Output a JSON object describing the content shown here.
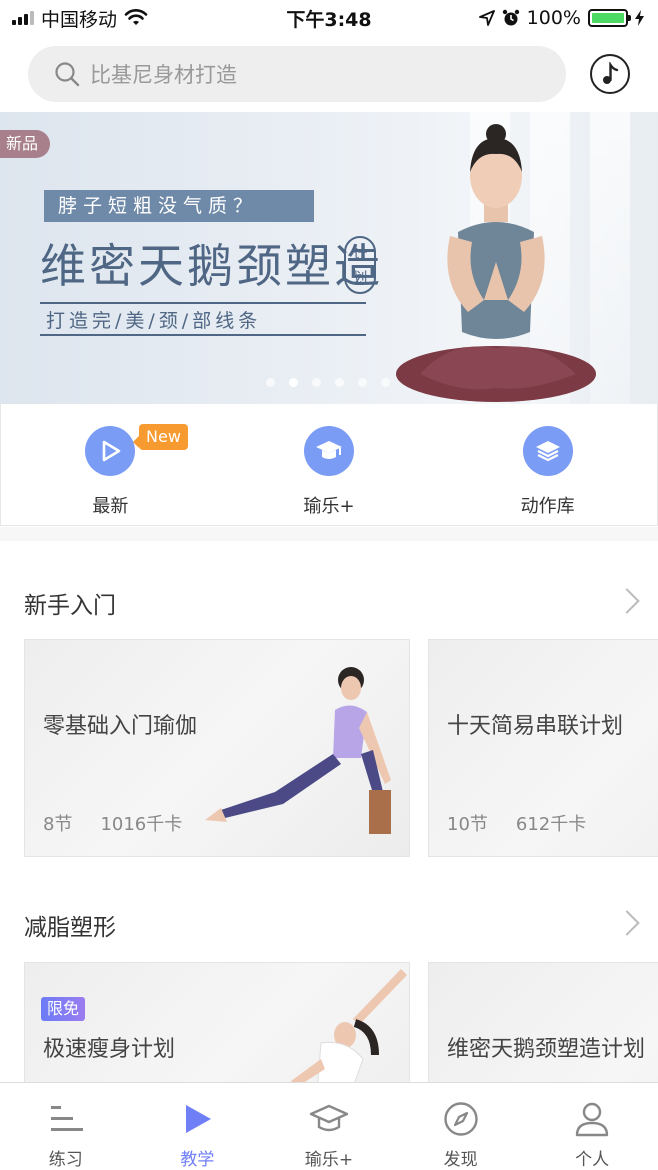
{
  "status_bar": {
    "carrier": "中国移动",
    "time": "下午3:48",
    "battery": "100%",
    "battery_level": 1.0
  },
  "search": {
    "placeholder": "比基尼身材打造",
    "search_icon": "search-icon",
    "music_icon": "music-note-icon"
  },
  "banner": {
    "badge": "新品",
    "question": "脖子短粗没气质？",
    "title": "维密天鹅颈塑造",
    "title_tag_1": "计",
    "title_tag_2": "划",
    "subtitle": "打造完/美/颈/部线条",
    "slides_count": 6,
    "active_slide": 1
  },
  "quick_nav": [
    {
      "label": "最新",
      "icon": "play-icon",
      "badge": "New"
    },
    {
      "label": "瑜乐+",
      "icon": "graduation-cap-icon"
    },
    {
      "label": "动作库",
      "icon": "layers-icon"
    }
  ],
  "sections": [
    {
      "title": "新手入门",
      "cards": [
        {
          "title": "零基础入门瑜伽",
          "lessons": "8节",
          "calories": "1016千卡"
        },
        {
          "title": "十天简易串联计划",
          "lessons": "10节",
          "calories": "612千卡"
        }
      ]
    },
    {
      "title": "减脂塑形",
      "cards": [
        {
          "tag": "限免",
          "title": "极速瘦身计划"
        },
        {
          "title": "维密天鹅颈塑造计划"
        }
      ]
    }
  ],
  "tab_bar": [
    {
      "label": "练习",
      "icon": "list-icon"
    },
    {
      "label": "教学",
      "icon": "play-triangle-icon",
      "active": true
    },
    {
      "label": "瑜乐+",
      "icon": "graduation-cap-icon"
    },
    {
      "label": "发现",
      "icon": "compass-icon"
    },
    {
      "label": "个人",
      "icon": "person-icon"
    }
  ],
  "colors": {
    "accent": "#6f7ff5",
    "quick_nav_icon": "#7b9cf5",
    "new_badge": "#f79a2f",
    "banner_text": "#4f6784"
  }
}
